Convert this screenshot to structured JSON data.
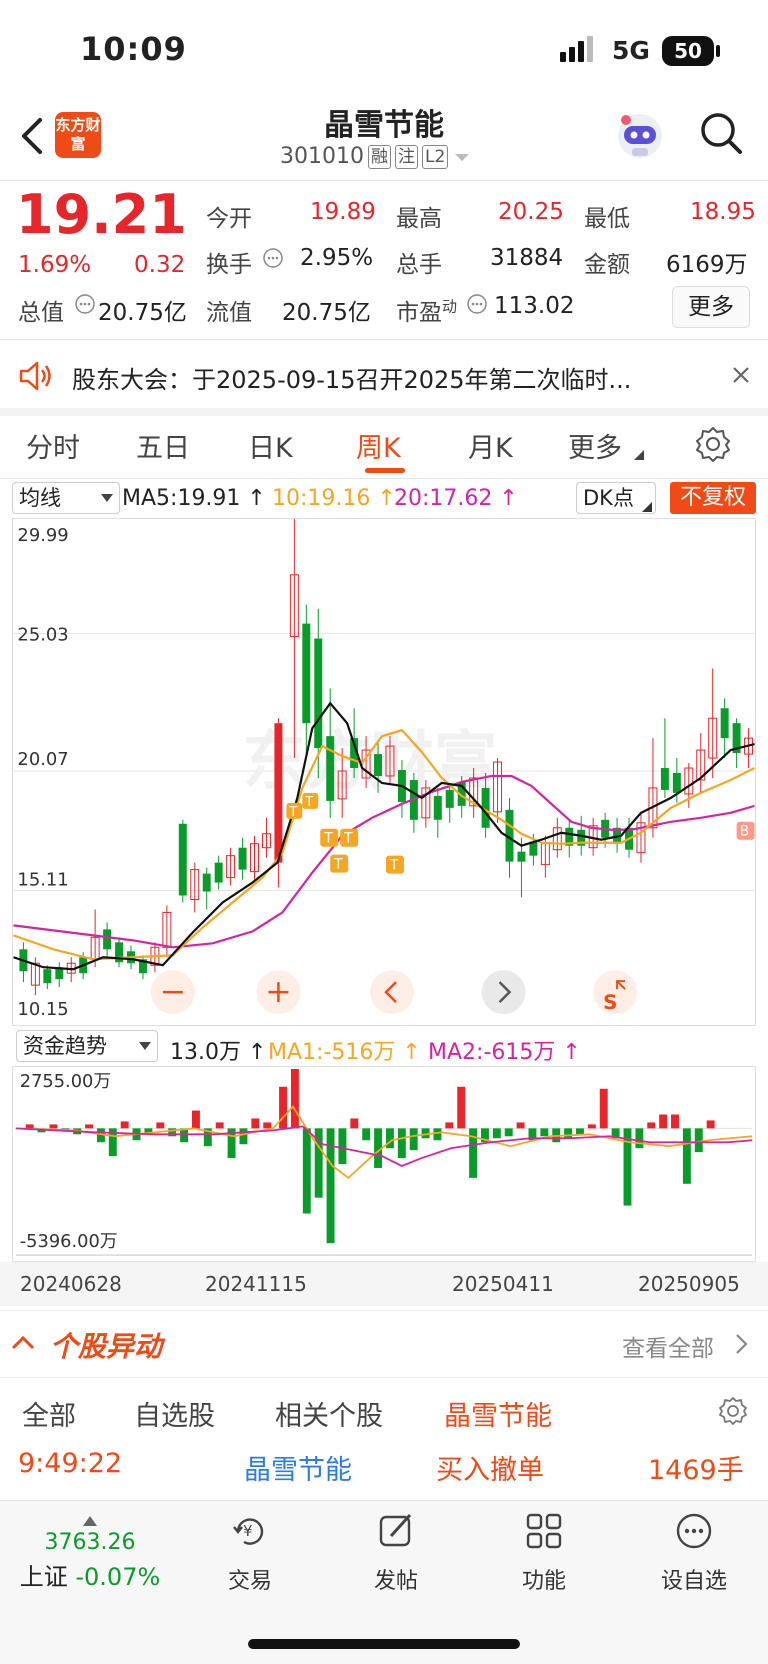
{
  "status_bar": {
    "time": "10:09",
    "network": "5G",
    "battery": "50"
  },
  "header": {
    "title": "晶雪节能",
    "code": "301010",
    "tags": [
      "融",
      "注",
      "L2"
    ],
    "logo_text": "东方财富"
  },
  "quote": {
    "price": "19.21",
    "change_pct": "1.69%",
    "change": "0.32",
    "fields": [
      {
        "label": "今开",
        "value": "19.89"
      },
      {
        "label": "最高",
        "value": "20.25"
      },
      {
        "label": "最低",
        "value": "18.95"
      },
      {
        "label": "换手",
        "value": "2.95%"
      },
      {
        "label": "总手",
        "value": "31884"
      },
      {
        "label": "金额",
        "value": "6169万"
      },
      {
        "label": "总值",
        "value": "20.75亿"
      },
      {
        "label": "流值",
        "value": "20.75亿"
      },
      {
        "label": "市盈",
        "sup": "动",
        "value": "113.02"
      }
    ],
    "more": "更多"
  },
  "notice": {
    "text": "股东大会：于2025-09-15召开2025年第二次临时..."
  },
  "tabs": [
    "分时",
    "五日",
    "日K",
    "周K",
    "月K",
    "更多"
  ],
  "active_tab": "周K",
  "ma_row": {
    "select": "均线",
    "ma5": "MA5:19.91",
    "ma10": "10:19.16",
    "ma20": "20:17.62",
    "dk": "DK点",
    "fq": "不复权"
  },
  "kline": {
    "yticks": [
      "29.99",
      "25.03",
      "20.07",
      "15.11",
      "10.15"
    ]
  },
  "fund_row": {
    "select": "资金趋势",
    "value": "13.0万",
    "ma1": "MA1:-516万",
    "ma2": "MA2:-615万"
  },
  "fund": {
    "ymax": "2755.00万",
    "ymin": "-5396.00万"
  },
  "dates": [
    "20240628",
    "20241115",
    "20250411",
    "20250905"
  ],
  "move": {
    "title": "个股异动",
    "all": "查看全部"
  },
  "subtabs": [
    "全部",
    "自选股",
    "相关个股",
    "晶雪节能"
  ],
  "row1": {
    "time": "9:49:22",
    "name": "晶雪节能",
    "action": "买入撤单",
    "vol": "1469手"
  },
  "bottom": {
    "index_value": "3763.26",
    "index_name": "上证",
    "index_change": "-0.07%",
    "items": [
      "交易",
      "发帖",
      "功能",
      "设自选"
    ]
  },
  "colors": {
    "up": "#e6262a",
    "down": "#0a9c2a",
    "accent": "#f04b16",
    "ma10": "#f5a623",
    "ma20": "#d6249f"
  }
}
